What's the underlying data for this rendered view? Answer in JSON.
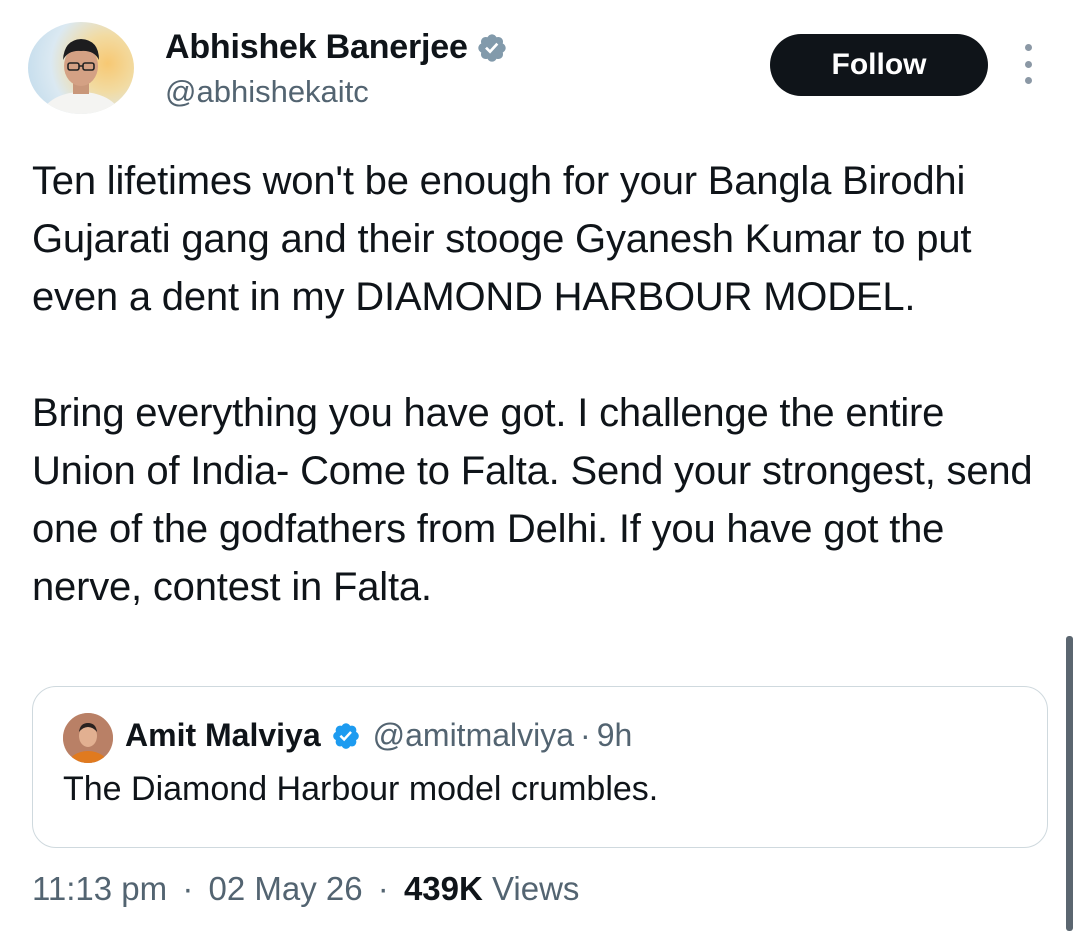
{
  "author": {
    "name": "Abhishek Banerjee",
    "handle": "@abhishekaitc",
    "verified_icon": "verified-badge-icon",
    "badge_color": "#829aab"
  },
  "actions": {
    "follow_label": "Follow",
    "more_icon": "more-vertical-icon"
  },
  "tweet": {
    "paragraphs": [
      "Ten lifetimes won't be enough for your Bangla Birodhi Gujarati gang and their stooge Gyanesh Kumar to put even a dent in my DIAMOND HARBOUR MODEL.",
      "Bring everything you have got. I challenge the entire Union of India- Come to Falta. Send your strongest, send one of the godfathers from Delhi. If you have got the nerve, contest in Falta."
    ]
  },
  "quoted_tweet": {
    "name": "Amit Malviya",
    "handle": "@amitmalviya",
    "separator": "·",
    "time": "9h",
    "text": "The Diamond Harbour model crumbles.",
    "badge_color": "#1d9bf0"
  },
  "meta": {
    "time": "11:13 pm",
    "separator": "·",
    "date": "02 May 26",
    "views_count": "439K",
    "views_label": "Views"
  },
  "colors": {
    "text_primary": "#0f1419",
    "text_secondary": "#536471",
    "border": "#cfd9de",
    "button_bg": "#0f1419"
  }
}
